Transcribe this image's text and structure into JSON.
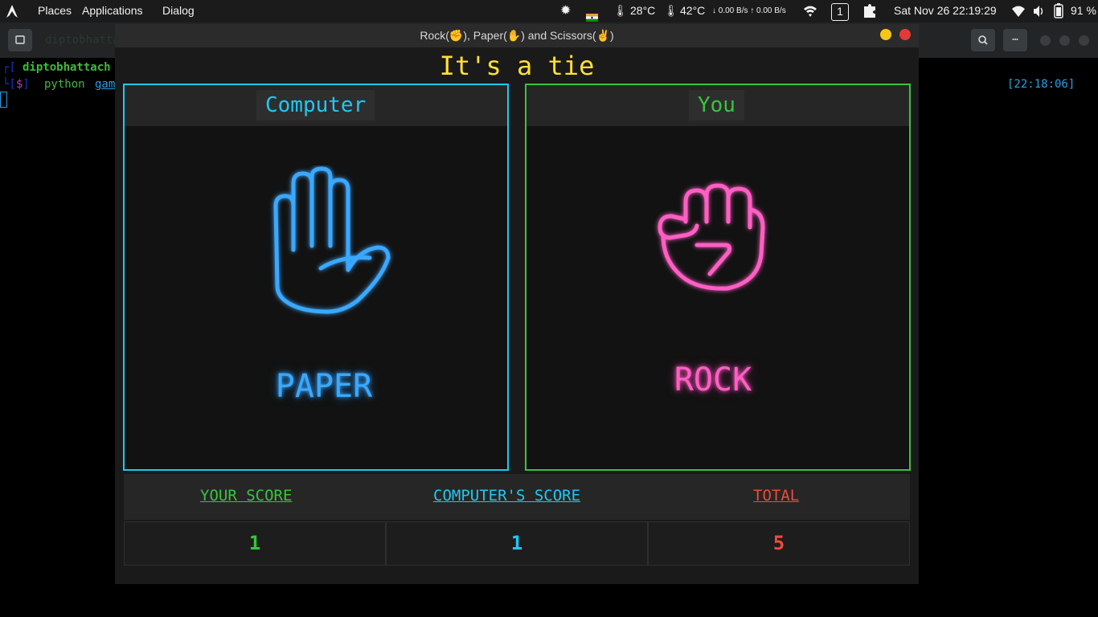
{
  "panel": {
    "places": "Places",
    "applications": "Applications",
    "dialog": "Dialog",
    "temp1": "28°C",
    "temp2": "42°C",
    "net": "↓ 0.00 B/s ↑ 0.00 B/s",
    "workspace": "1",
    "datetime": "Sat Nov 26  22:19:29",
    "battery": "91 %"
  },
  "terminal": {
    "tab_label": "diptobhattach",
    "user": "diptobhattach",
    "prompt_sym": "$",
    "command": "python",
    "arg": "gam",
    "timestamp": "[22:18:06]"
  },
  "window": {
    "title": "Rock(✊), Paper(✋) and Scissors(✌)"
  },
  "game": {
    "status": "It's a tie",
    "computer": {
      "label": "Computer",
      "choice": "PAPER"
    },
    "player": {
      "label": "You",
      "choice": "ROCK"
    }
  },
  "scores": {
    "your_label": "YOUR SCORE",
    "computer_label": "COMPUTER'S SCORE",
    "total_label": "TOTAL",
    "your_value": "1",
    "computer_value": "1",
    "total_value": "5"
  },
  "colors": {
    "computer": "#1ec8f5",
    "player": "#39c43d",
    "total": "#ef4a3a",
    "status": "#ffe135",
    "paper_neon": "#3aa8ff",
    "rock_neon": "#ff5fc4"
  }
}
